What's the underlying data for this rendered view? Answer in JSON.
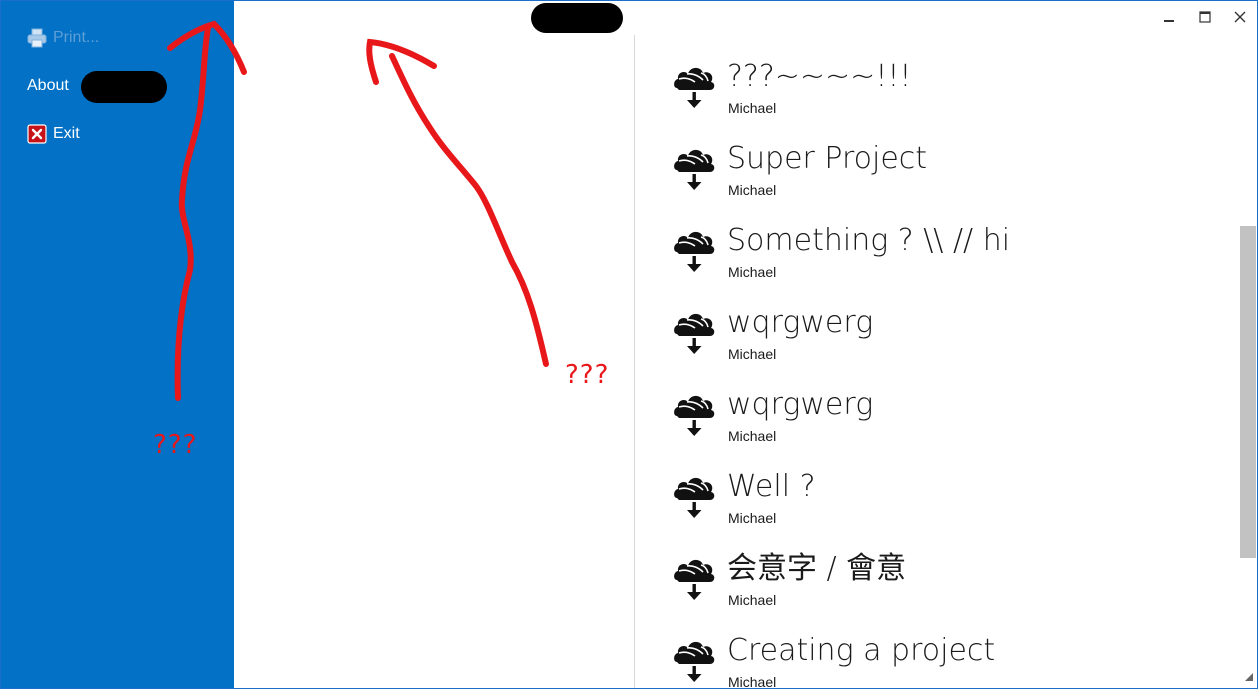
{
  "sidebar": {
    "items": [
      {
        "label": "Print...",
        "icon": "printer-icon",
        "enabled": false
      },
      {
        "label": "About",
        "icon": null,
        "enabled": true
      },
      {
        "label": "Exit",
        "icon": "close-x-icon",
        "enabled": true
      }
    ]
  },
  "titlebar": {
    "controls": [
      "minimize-icon",
      "maximize-icon",
      "close-icon"
    ]
  },
  "projects": [
    {
      "title": "???~~~~!!!",
      "owner": "Michael"
    },
    {
      "title": "Super Project",
      "owner": "Michael"
    },
    {
      "title": "Something ? \\\\ // hi",
      "owner": "Michael"
    },
    {
      "title": "wqrgwerg",
      "owner": "Michael"
    },
    {
      "title": "wqrgwerg",
      "owner": "Michael"
    },
    {
      "title": "Well ?",
      "owner": "Michael"
    },
    {
      "title": "会意字 / 會意",
      "owner": "Michael"
    },
    {
      "title": "Creating a project",
      "owner": "Michael"
    }
  ],
  "annotations": {
    "label_left": "???",
    "label_right": "???"
  },
  "colors": {
    "sidebar_bg": "#0271c6",
    "annotation": "#e8171a",
    "scroll_thumb": "#c2c2c2"
  }
}
